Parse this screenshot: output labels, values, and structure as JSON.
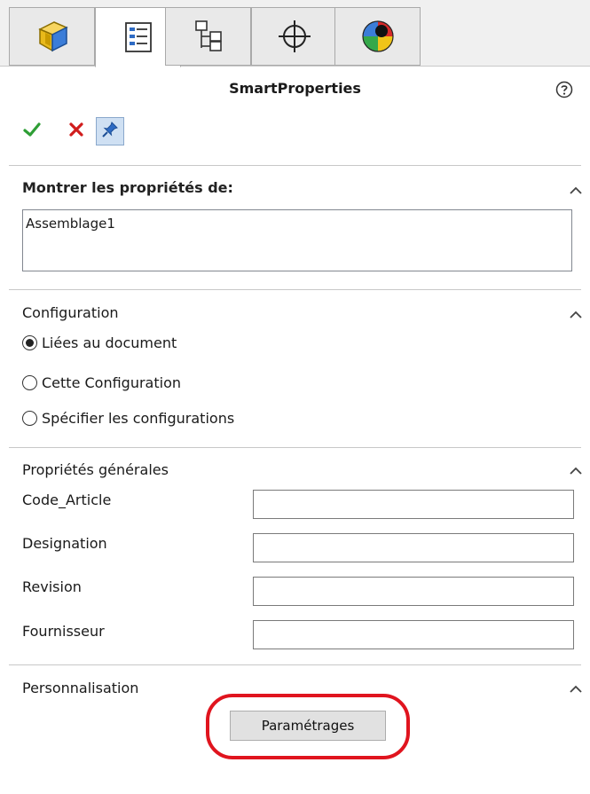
{
  "tabs": [
    {
      "icon": "feature-manager-icon"
    },
    {
      "icon": "property-manager-icon"
    },
    {
      "icon": "configuration-manager-icon"
    },
    {
      "icon": "dimxpert-manager-icon"
    },
    {
      "icon": "display-manager-icon"
    }
  ],
  "header": {
    "title": "SmartProperties",
    "help_icon": "help-icon"
  },
  "actions": {
    "ok": "checkmark-icon",
    "cancel": "cross-icon",
    "pin": "pin-icon"
  },
  "show_properties": {
    "title": "Montrer les propriétés de:",
    "items": [
      "Assemblage1"
    ]
  },
  "configuration": {
    "title": "Configuration",
    "options": [
      {
        "label": "Liées au document",
        "selected": true
      },
      {
        "label": "Cette Configuration",
        "selected": false
      },
      {
        "label": "Spécifier les configurations",
        "selected": false
      }
    ]
  },
  "general_properties": {
    "title": "Propriétés générales",
    "fields": [
      {
        "label": "Code_Article",
        "value": ""
      },
      {
        "label": "Designation",
        "value": ""
      },
      {
        "label": "Revision",
        "value": ""
      },
      {
        "label": "Fournisseur",
        "value": ""
      }
    ]
  },
  "customization": {
    "title": "Personnalisation",
    "button_label": "Paramétrages"
  },
  "colors": {
    "accent_highlight": "#e0141e",
    "ok_green": "#2e9e35",
    "cancel_red": "#d01c1c"
  }
}
